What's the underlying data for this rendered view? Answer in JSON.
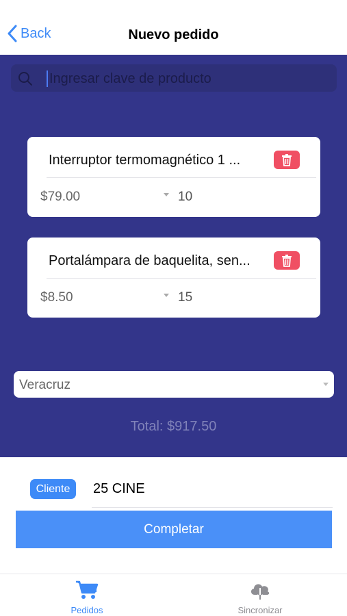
{
  "nav": {
    "back_label": "Back",
    "title": "Nuevo pedido"
  },
  "search": {
    "placeholder": "Ingresar clave de producto",
    "value": ""
  },
  "products": [
    {
      "name": "Interruptor termomagnético 1 ...",
      "price": "$79.00",
      "quantity": "10"
    },
    {
      "name": "Portalámpara de baquelita, sen...",
      "price": "$8.50",
      "quantity": "15"
    }
  ],
  "location_select": {
    "value": "Veracruz"
  },
  "total": "Total: $917.50",
  "client": {
    "badge_label": "Cliente",
    "value": "25 CINE"
  },
  "complete_button": "Completar",
  "tabs": [
    {
      "label": "Pedidos",
      "icon": "cart-icon",
      "active": true
    },
    {
      "label": "Sincronizar",
      "icon": "cloud-download-icon",
      "active": false
    }
  ],
  "colors": {
    "accent": "#3d8af7",
    "main_background": "#33358a",
    "delete": "#f04f63"
  }
}
